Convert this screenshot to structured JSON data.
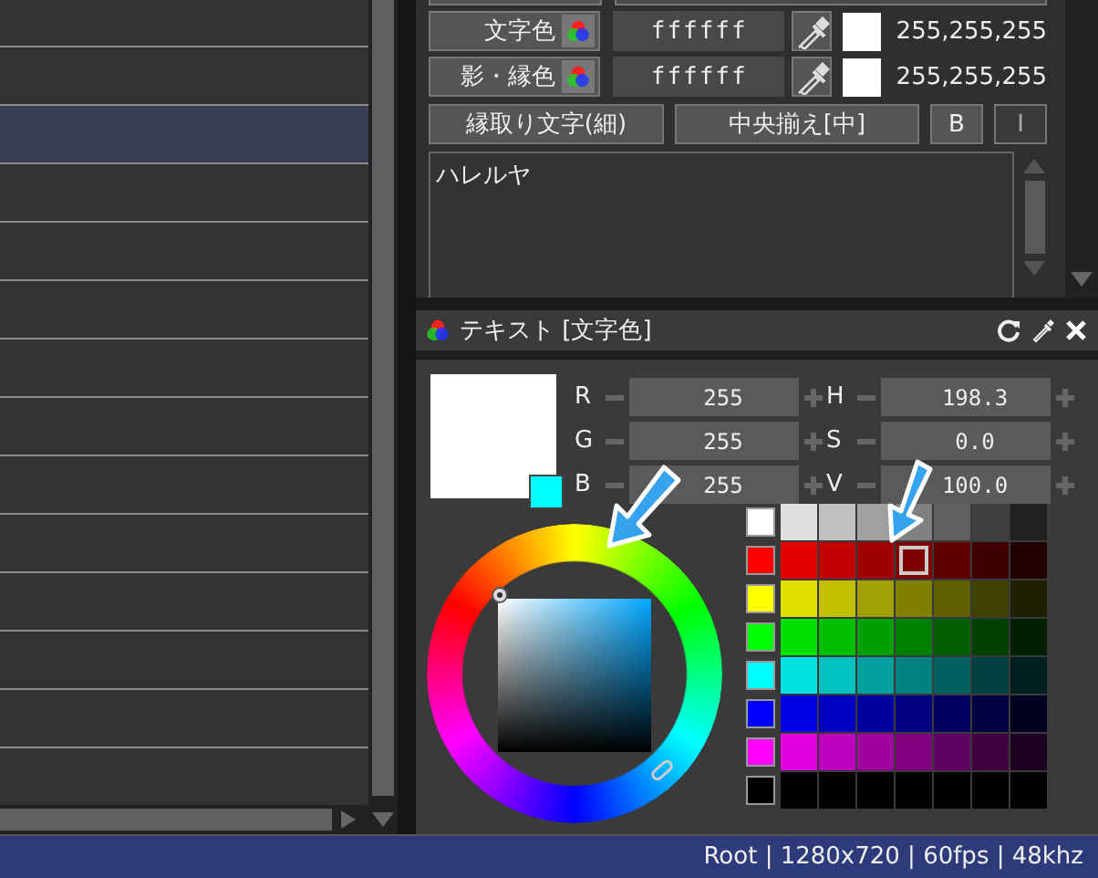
{
  "timeline": {
    "rows": [
      {
        "selected": false
      },
      {
        "selected": true
      },
      {
        "selected": false
      },
      {
        "selected": false
      },
      {
        "selected": false
      },
      {
        "selected": false
      },
      {
        "selected": false
      },
      {
        "selected": false
      },
      {
        "selected": false
      },
      {
        "selected": false
      },
      {
        "selected": false
      },
      {
        "selected": false
      },
      {
        "selected": false
      }
    ]
  },
  "text_props": {
    "color_rows": [
      {
        "label": "文字色",
        "hex": "ffffff",
        "rgb": "255,255,255"
      },
      {
        "label": "影・縁色",
        "hex": "ffffff",
        "rgb": "255,255,255"
      }
    ],
    "buttons": [
      {
        "label": "縁取り文字(細)",
        "kind": "wide"
      },
      {
        "label": "中央揃え[中]",
        "kind": "wide"
      },
      {
        "label": "B",
        "kind": "toggle",
        "on": true
      },
      {
        "label": "I",
        "kind": "toggle",
        "on": false
      }
    ],
    "text_value": "ハレルヤ"
  },
  "color_panel": {
    "title": "テキスト [文字色]",
    "rgb": [
      {
        "label": "R",
        "value": "255"
      },
      {
        "label": "G",
        "value": "255"
      },
      {
        "label": "B",
        "value": "255"
      }
    ],
    "hsv": [
      {
        "label": "H",
        "value": "198.3"
      },
      {
        "label": "S",
        "value": "0.0"
      },
      {
        "label": "V",
        "value": "100.0"
      }
    ],
    "palette": [
      [
        {
          "color": "#ffffff",
          "selected": false
        },
        {
          "color": "#e0e0e0",
          "selected": false
        },
        {
          "color": "#c0c0c0",
          "selected": false
        },
        {
          "color": "#a0a0a0",
          "selected": false
        },
        {
          "color": "#808080",
          "selected": false
        },
        {
          "color": "#606060",
          "selected": false
        },
        {
          "color": "#404040",
          "selected": false
        },
        {
          "color": "#202020",
          "selected": false
        }
      ],
      [
        {
          "color": "#ff0000",
          "selected": false
        },
        {
          "color": "#e00000",
          "selected": false
        },
        {
          "color": "#c00000",
          "selected": false
        },
        {
          "color": "#a00000",
          "selected": false
        },
        {
          "color": "#800000",
          "selected": true
        },
        {
          "color": "#600000",
          "selected": false
        },
        {
          "color": "#400000",
          "selected": false
        },
        {
          "color": "#200000",
          "selected": false
        }
      ],
      [
        {
          "color": "#ffff00",
          "selected": false
        },
        {
          "color": "#e0e000",
          "selected": false
        },
        {
          "color": "#c0c000",
          "selected": false
        },
        {
          "color": "#a0a000",
          "selected": false
        },
        {
          "color": "#808000",
          "selected": false
        },
        {
          "color": "#606000",
          "selected": false
        },
        {
          "color": "#404000",
          "selected": false
        },
        {
          "color": "#202000",
          "selected": false
        }
      ],
      [
        {
          "color": "#00ff00",
          "selected": false
        },
        {
          "color": "#00e000",
          "selected": false
        },
        {
          "color": "#00c000",
          "selected": false
        },
        {
          "color": "#00a000",
          "selected": false
        },
        {
          "color": "#008000",
          "selected": false
        },
        {
          "color": "#006000",
          "selected": false
        },
        {
          "color": "#004000",
          "selected": false
        },
        {
          "color": "#002000",
          "selected": false
        }
      ],
      [
        {
          "color": "#00ffff",
          "selected": false
        },
        {
          "color": "#00e0e0",
          "selected": false
        },
        {
          "color": "#00c0c0",
          "selected": false
        },
        {
          "color": "#00a0a0",
          "selected": false
        },
        {
          "color": "#008080",
          "selected": false
        },
        {
          "color": "#006060",
          "selected": false
        },
        {
          "color": "#004040",
          "selected": false
        },
        {
          "color": "#002020",
          "selected": false
        }
      ],
      [
        {
          "color": "#0000ff",
          "selected": false
        },
        {
          "color": "#0000e0",
          "selected": false
        },
        {
          "color": "#0000c0",
          "selected": false
        },
        {
          "color": "#0000a0",
          "selected": false
        },
        {
          "color": "#000080",
          "selected": false
        },
        {
          "color": "#000060",
          "selected": false
        },
        {
          "color": "#000040",
          "selected": false
        },
        {
          "color": "#000020",
          "selected": false
        }
      ],
      [
        {
          "color": "#ff00ff",
          "selected": false
        },
        {
          "color": "#e000e0",
          "selected": false
        },
        {
          "color": "#c000c0",
          "selected": false
        },
        {
          "color": "#a000a0",
          "selected": false
        },
        {
          "color": "#800080",
          "selected": false
        },
        {
          "color": "#600060",
          "selected": false
        },
        {
          "color": "#400040",
          "selected": false
        },
        {
          "color": "#200020",
          "selected": false
        }
      ],
      [
        {
          "color": "#000000",
          "selected": false
        },
        {
          "color": "#000000",
          "selected": false
        },
        {
          "color": "#000000",
          "selected": false
        },
        {
          "color": "#000000",
          "selected": false
        },
        {
          "color": "#000000",
          "selected": false
        },
        {
          "color": "#000000",
          "selected": false
        },
        {
          "color": "#000000",
          "selected": false
        },
        {
          "color": "#000000",
          "selected": false
        }
      ]
    ]
  },
  "status_bar": {
    "text": "Root | 1280x720 | 60fps | 48khz"
  }
}
